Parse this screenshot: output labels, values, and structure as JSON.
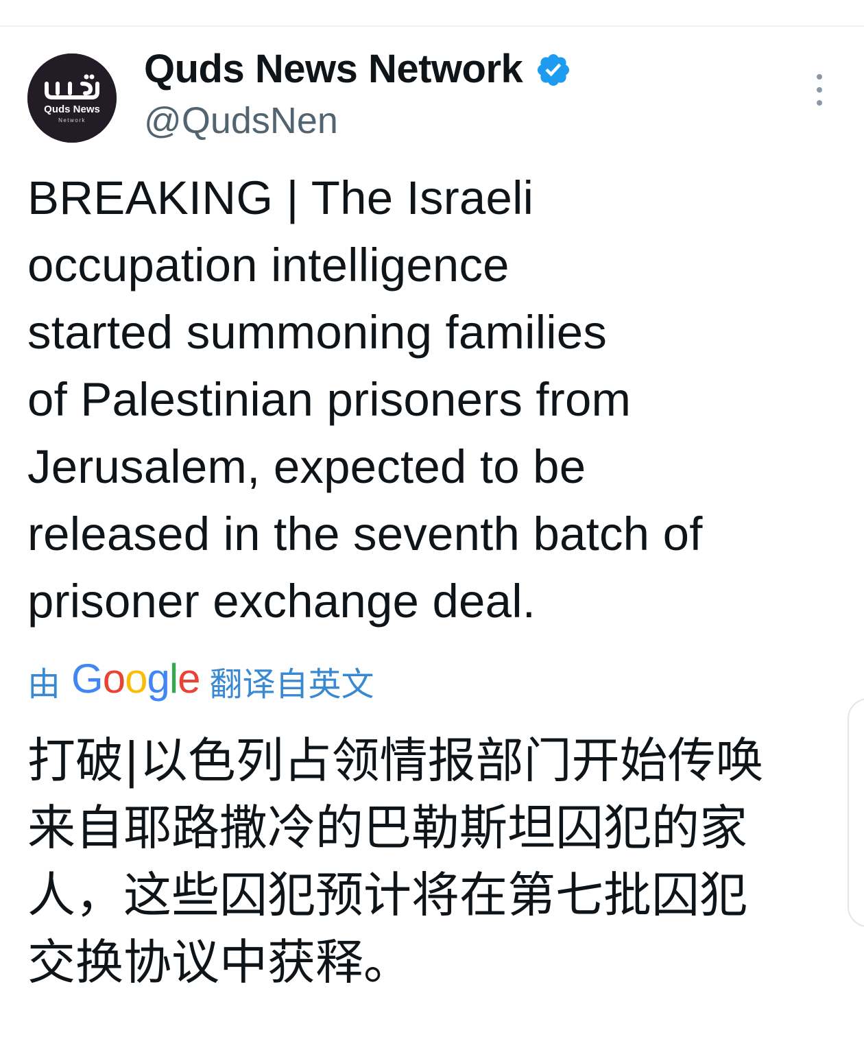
{
  "tweet": {
    "author": {
      "display_name": "Quds News Network",
      "handle": "@QudsNen",
      "verified": true,
      "avatar": {
        "logo_text": "Quds News",
        "logo_subtext": "Network",
        "background": "#221c26"
      }
    },
    "more_icon": "more-vertical-icon",
    "text_lines": [
      "BREAKING | The Israeli",
      "occupation intelligence",
      "started summoning families",
      "of Palestinian prisoners from",
      "Jerusalem, expected to be",
      "released in the seventh batch of",
      "prisoner exchange deal."
    ],
    "translation": {
      "prefix": "由",
      "provider": "Google",
      "suffix": "翻译自英文",
      "text_lines": [
        "打破|以色列占领情报部门开始传唤",
        "来自耶路撒冷的巴勒斯坦囚犯的家",
        "人，这些囚犯预计将在第七批囚犯",
        "交换协议中获释。"
      ]
    }
  },
  "colors": {
    "text_primary": "#0f1419",
    "text_secondary": "#536471",
    "link_blue": "#3889d2",
    "verified_blue": "#1d9bf0",
    "google_blue": "#4285f4",
    "google_red": "#ea4335",
    "google_yellow": "#fbbc05",
    "google_green": "#34a853"
  }
}
